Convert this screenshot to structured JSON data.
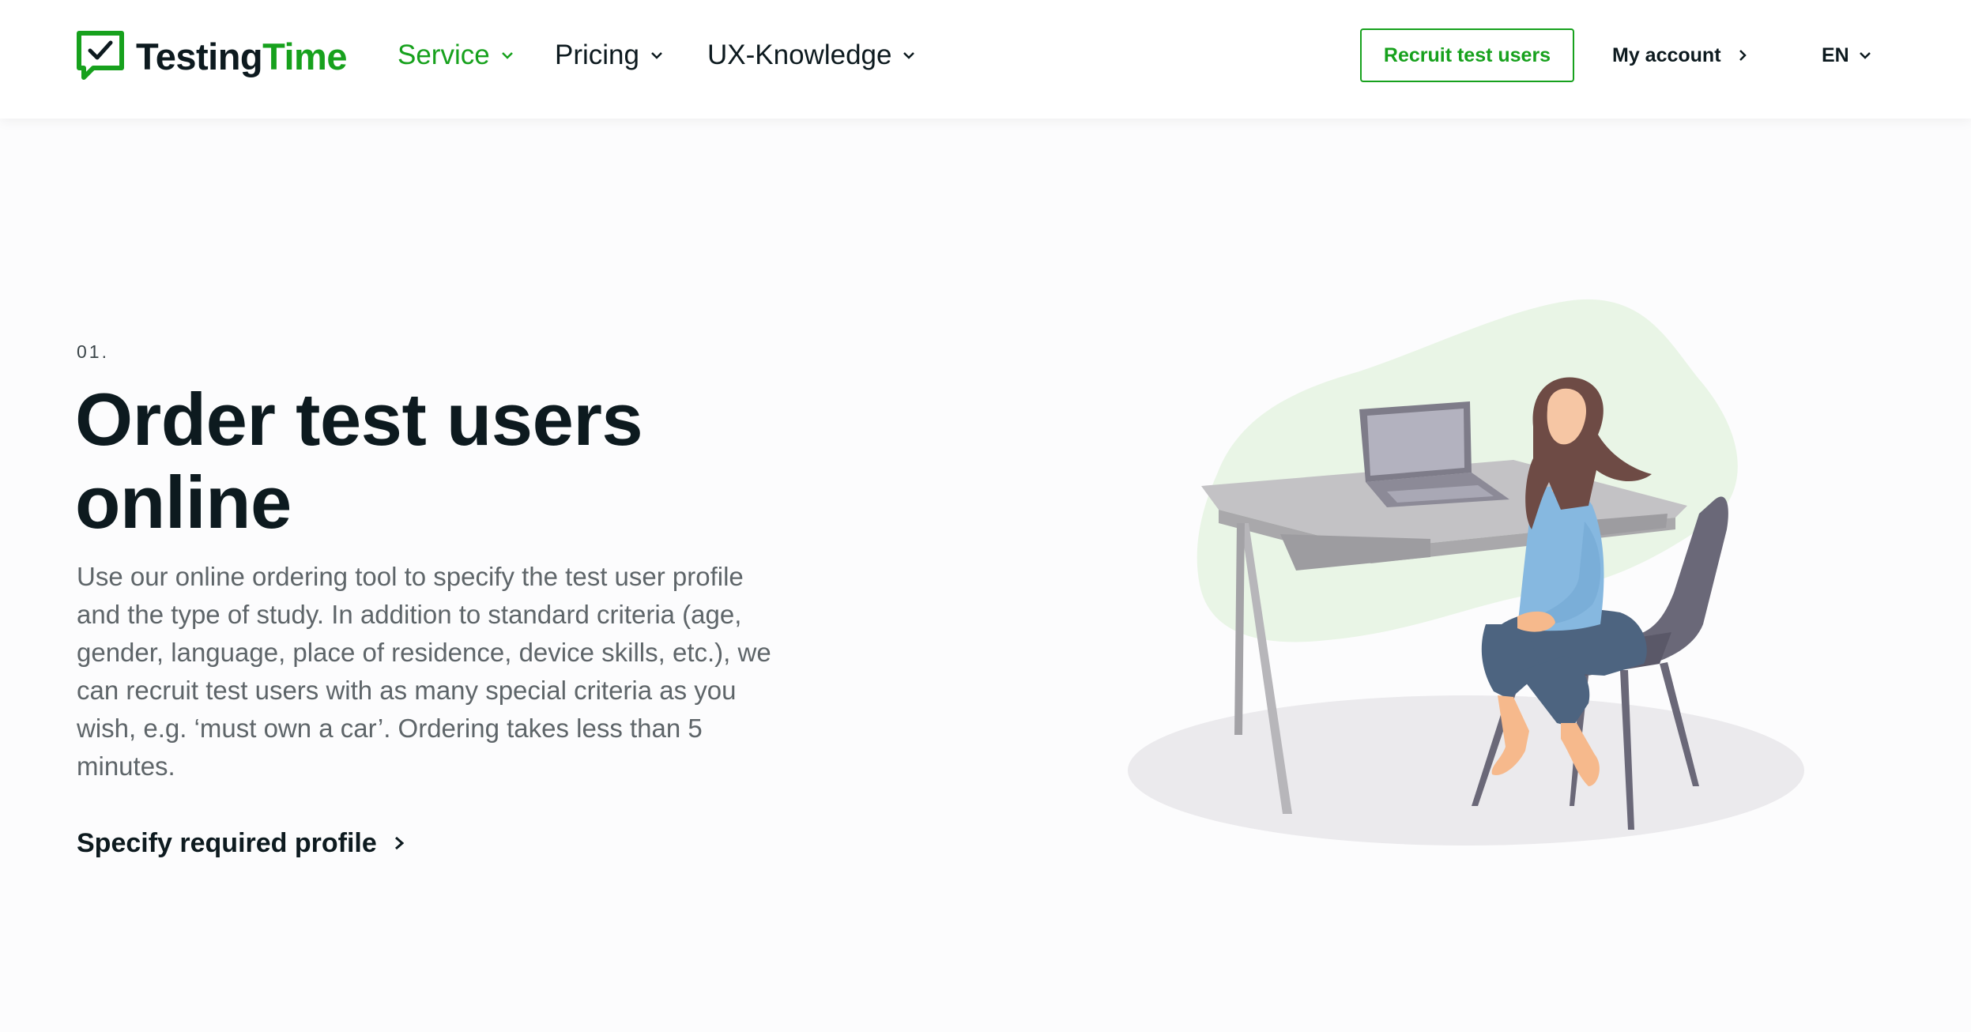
{
  "header": {
    "logo": {
      "part1": "Testing",
      "part2": "Time",
      "icon": "chat-check-icon"
    },
    "nav": [
      {
        "label": "Service",
        "active": true
      },
      {
        "label": "Pricing",
        "active": false
      },
      {
        "label": "UX-Knowledge",
        "active": false
      }
    ],
    "recruit_button": "Recruit test users",
    "my_account": "My account",
    "language": "EN"
  },
  "hero": {
    "step": "01.",
    "title_line1": "Order test users",
    "title_line2": "online",
    "description": "Use our online ordering tool to specify the test user profile and the type of study. In addition to standard criteria (age, gender, language, place of residence, device skills, etc.), we can recruit test users with as many special criteria as you wish, e.g. ‘must own a car’. Ordering takes less than 5 minutes.",
    "cta": "Specify required profile"
  },
  "colors": {
    "brand_green": "#17a11d",
    "text_dark": "#0d1a1f",
    "text_muted": "#5e6569"
  }
}
